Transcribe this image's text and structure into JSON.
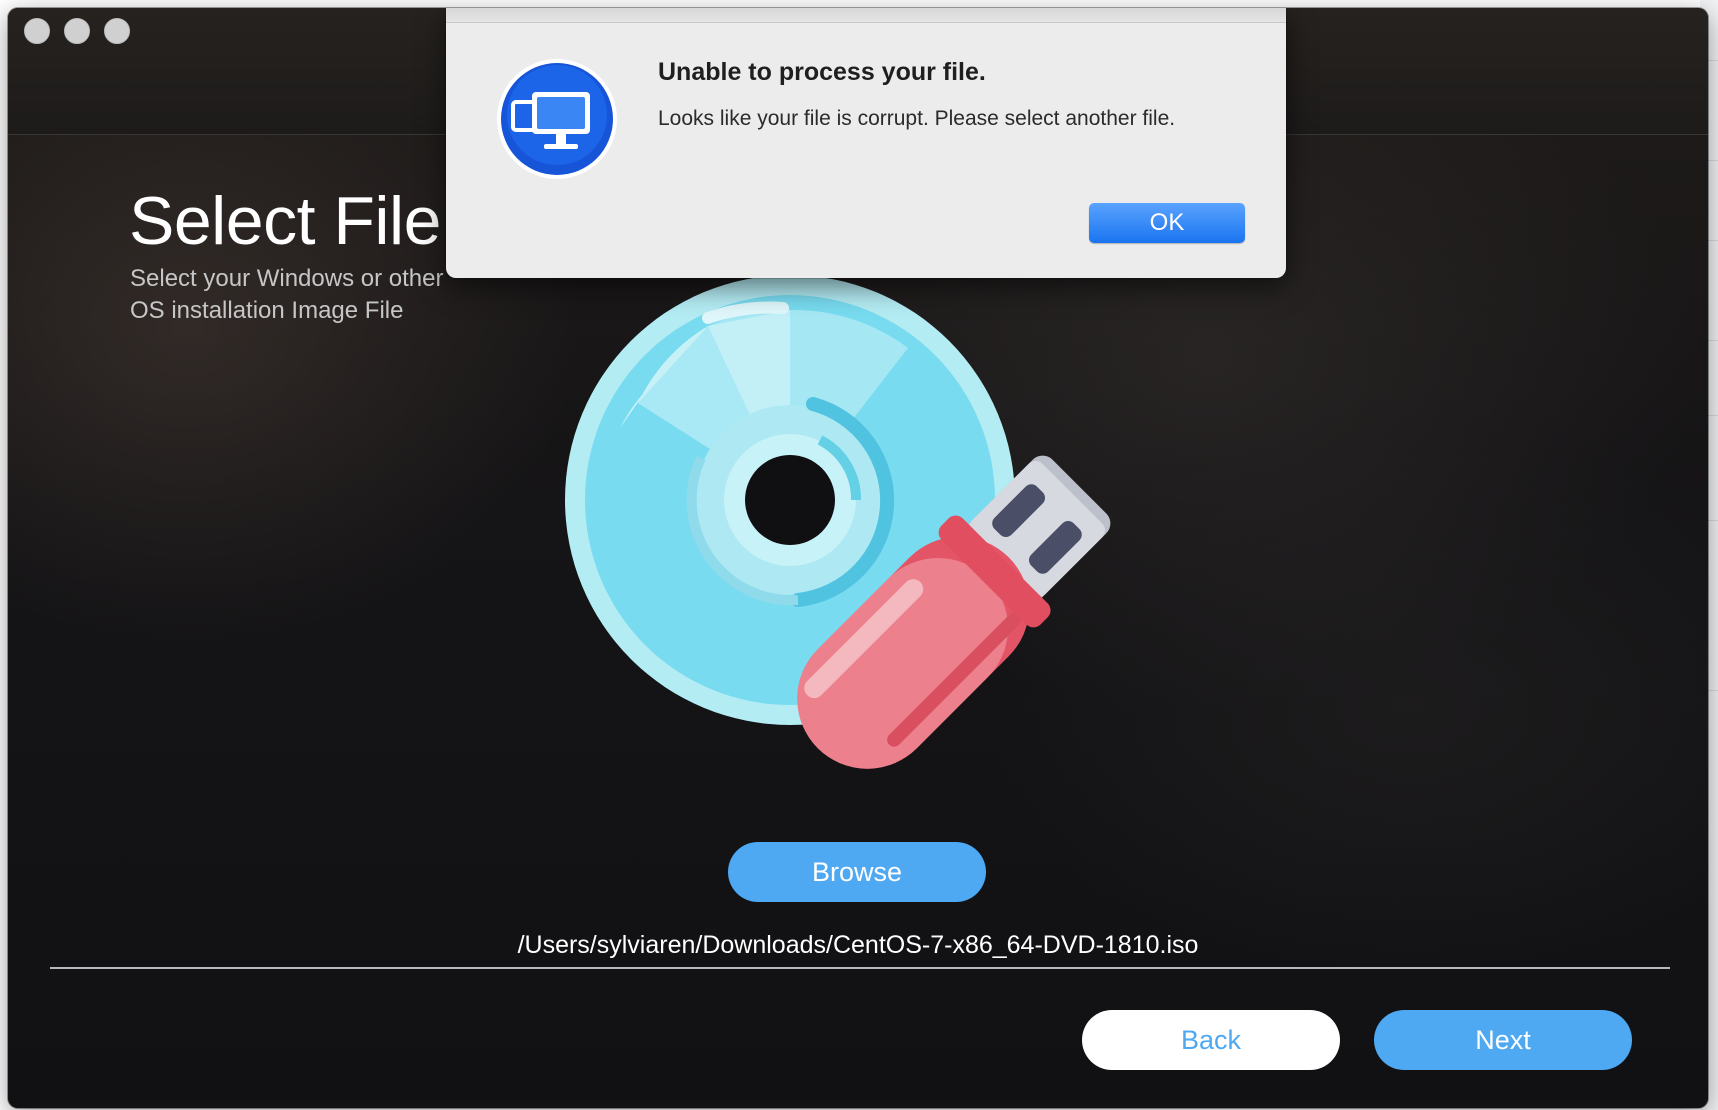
{
  "window": {
    "title_area": "",
    "heading": "Select File",
    "subheading": "Select your Windows or other OS installation Image File"
  },
  "controls": {
    "browse_label": "Browse",
    "file_path": "/Users/sylviaren/Downloads/CentOS-7-x86_64-DVD-1810.iso",
    "back_label": "Back",
    "next_label": "Next"
  },
  "alert": {
    "title": "Unable to process your file.",
    "message": "Looks like your file is corrupt. Please select another  file.",
    "ok_label": "OK"
  },
  "icons": {
    "app_icon": "monitor-duplicate-icon",
    "disc": "disc-icon",
    "usb": "usb-drive-icon"
  },
  "colors": {
    "accent": "#4ea9f2",
    "alert_button": "#1a74f0",
    "disc_light": "#8ee2f3",
    "usb_red": "#e8566a"
  }
}
